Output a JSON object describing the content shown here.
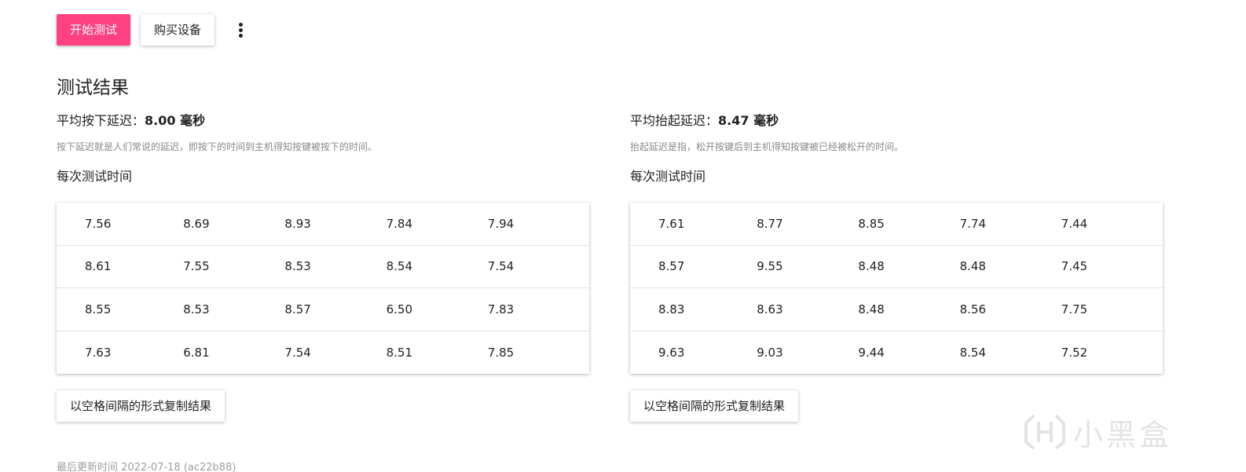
{
  "toolbar": {
    "start_label": "开始测试",
    "buy_label": "购买设备",
    "more_icon": "more-vert-icon"
  },
  "results": {
    "title": "测试结果",
    "press": {
      "avg_label": "平均按下延迟：",
      "avg_value": "8.00 毫秒",
      "description": "按下延迟就是人们常说的延迟，即按下的时间到主机得知按键被按下的时间。",
      "each_label": "每次测试时间",
      "rows": [
        [
          "7.56",
          "8.69",
          "8.93",
          "7.84",
          "7.94"
        ],
        [
          "8.61",
          "7.55",
          "8.53",
          "8.54",
          "7.54"
        ],
        [
          "8.55",
          "8.53",
          "8.57",
          "6.50",
          "7.83"
        ],
        [
          "7.63",
          "6.81",
          "7.54",
          "8.51",
          "7.85"
        ]
      ],
      "copy_label": "以空格间隔的形式复制结果"
    },
    "release": {
      "avg_label": "平均抬起延迟：",
      "avg_value": "8.47 毫秒",
      "description": "抬起延迟是指，松开按键后到主机得知按键被已经被松开的时间。",
      "each_label": "每次测试时间",
      "rows": [
        [
          "7.61",
          "8.77",
          "8.85",
          "7.74",
          "7.44"
        ],
        [
          "8.57",
          "9.55",
          "8.48",
          "8.48",
          "7.45"
        ],
        [
          "8.83",
          "8.63",
          "8.48",
          "8.56",
          "7.75"
        ],
        [
          "9.63",
          "9.03",
          "9.44",
          "8.54",
          "7.52"
        ]
      ],
      "copy_label": "以空格间隔的形式复制结果"
    }
  },
  "footer": {
    "updated": "最后更新时间 2022-07-18 (ac22b88)"
  },
  "watermark": {
    "text": "小黑盒"
  },
  "colors": {
    "accent": "#ff4081"
  }
}
